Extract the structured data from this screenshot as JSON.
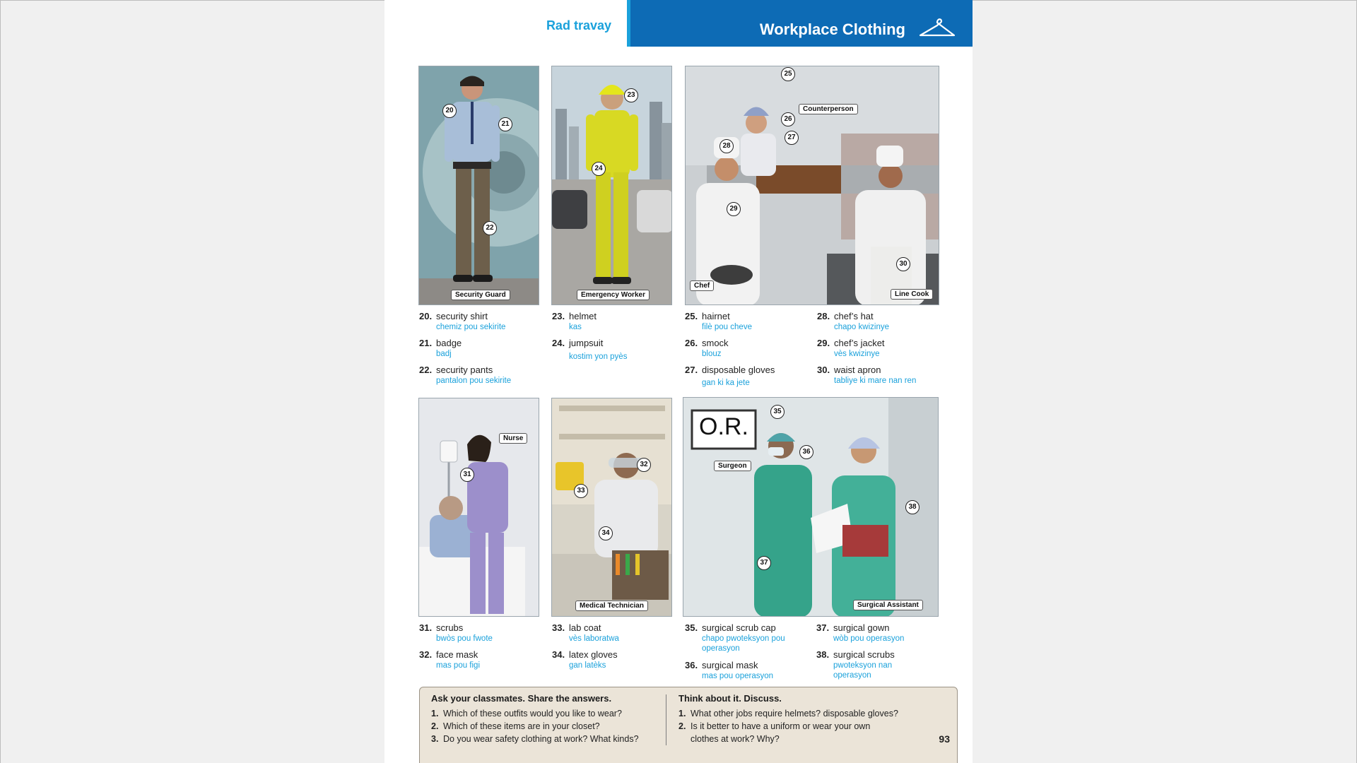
{
  "header": {
    "section_label": "Rad travay",
    "title": "Workplace Clothing",
    "icon": "hanger-icon"
  },
  "scenes": {
    "security_guard": "Security Guard",
    "emergency_worker": "Emergency Worker",
    "counterperson": "Counterperson",
    "chef": "Chef",
    "line_cook": "Line Cook",
    "nurse": "Nurse",
    "medical_technician": "Medical Technician",
    "or_sign": "O.R.",
    "surgeon": "Surgeon",
    "surgical_assistant": "Surgical Assistant"
  },
  "callouts": [
    "20",
    "21",
    "22",
    "23",
    "24",
    "25",
    "26",
    "27",
    "28",
    "29",
    "30",
    "31",
    "32",
    "33",
    "34",
    "35",
    "36",
    "37",
    "38"
  ],
  "entries": [
    {
      "num": "20.",
      "en": "security shirt",
      "ht": "chemiz pou sekirite"
    },
    {
      "num": "21.",
      "en": "badge",
      "ht": "badj"
    },
    {
      "num": "22.",
      "en": "security pants",
      "ht": "pantalon pou sekirite"
    },
    {
      "num": "23.",
      "en": "helmet",
      "ht": "kas"
    },
    {
      "num": "24.",
      "en": "jumpsuit",
      "ht": "kostim yon pyès"
    },
    {
      "num": "25.",
      "en": "hairnet",
      "ht": "filè pou cheve"
    },
    {
      "num": "26.",
      "en": "smock",
      "ht": "blouz"
    },
    {
      "num": "27.",
      "en": "disposable gloves",
      "ht": "gan ki ka jete"
    },
    {
      "num": "28.",
      "en": "chef’s hat",
      "ht": "chapo kwizinye"
    },
    {
      "num": "29.",
      "en": "chef’s jacket",
      "ht": "vès kwizinye"
    },
    {
      "num": "30.",
      "en": "waist apron",
      "ht": "tabliye ki mare nan ren"
    },
    {
      "num": "31.",
      "en": "scrubs",
      "ht": "bwòs pou fwote"
    },
    {
      "num": "32.",
      "en": "face mask",
      "ht": "mas pou figi"
    },
    {
      "num": "33.",
      "en": "lab coat",
      "ht": "vès laboratwa"
    },
    {
      "num": "34.",
      "en": "latex gloves",
      "ht": "gan latèks"
    },
    {
      "num": "35.",
      "en": "surgical scrub cap",
      "ht": "chapo pwoteksyon pou operasyon"
    },
    {
      "num": "36.",
      "en": "surgical mask",
      "ht": "mas pou operasyon"
    },
    {
      "num": "37.",
      "en": "surgical gown",
      "ht": "wòb pou operasyon"
    },
    {
      "num": "38.",
      "en": "surgical scrubs",
      "ht": "pwoteksyon nan operasyon"
    }
  ],
  "questions": {
    "left_title": "Ask your classmates. Share the answers.",
    "left": [
      {
        "n": "1.",
        "text": "Which of these outfits would you like to wear?"
      },
      {
        "n": "2.",
        "text": "Which of these items are in your closet?"
      },
      {
        "n": "3.",
        "text": "Do you wear safety clothing at work? What kinds?"
      }
    ],
    "right_title": "Think about it. Discuss.",
    "right": [
      {
        "n": "1.",
        "text": "What other jobs require helmets? disposable gloves?"
      },
      {
        "n": "2.",
        "text": "Is it better to have a uniform or wear your own",
        "cont": "clothes at work? Why?"
      }
    ]
  },
  "page_number": "93",
  "colors": {
    "header_blue": "#0d6bb5",
    "accent_cyan": "#1aa1db",
    "question_box": "#ebe4d8"
  }
}
